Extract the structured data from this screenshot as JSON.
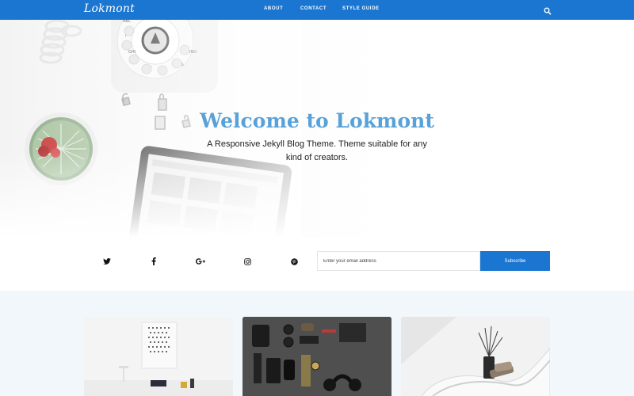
{
  "nav": {
    "brand": "Lokmont",
    "links": [
      "ABOUT",
      "CONTACT",
      "STYLE GUIDE"
    ],
    "search_icon": "search-icon",
    "color": "#1b76d1"
  },
  "hero": {
    "title": "Welcome to Lokmont",
    "subtitle": "A Responsive Jekyll Blog Theme. Theme suitable for any kind of creators.",
    "title_color": "#59a2d9"
  },
  "social": {
    "icons": [
      "twitter-icon",
      "facebook-icon",
      "google-plus-icon",
      "instagram-icon",
      "pinterest-icon"
    ]
  },
  "subscribe": {
    "placeholder": "Enter your email address",
    "button_label": "Subscribe"
  },
  "posts": [
    {
      "image": "white-desk-photo"
    },
    {
      "image": "flatlay-accessories-photo"
    },
    {
      "image": "white-lounge-chair-photo"
    }
  ]
}
